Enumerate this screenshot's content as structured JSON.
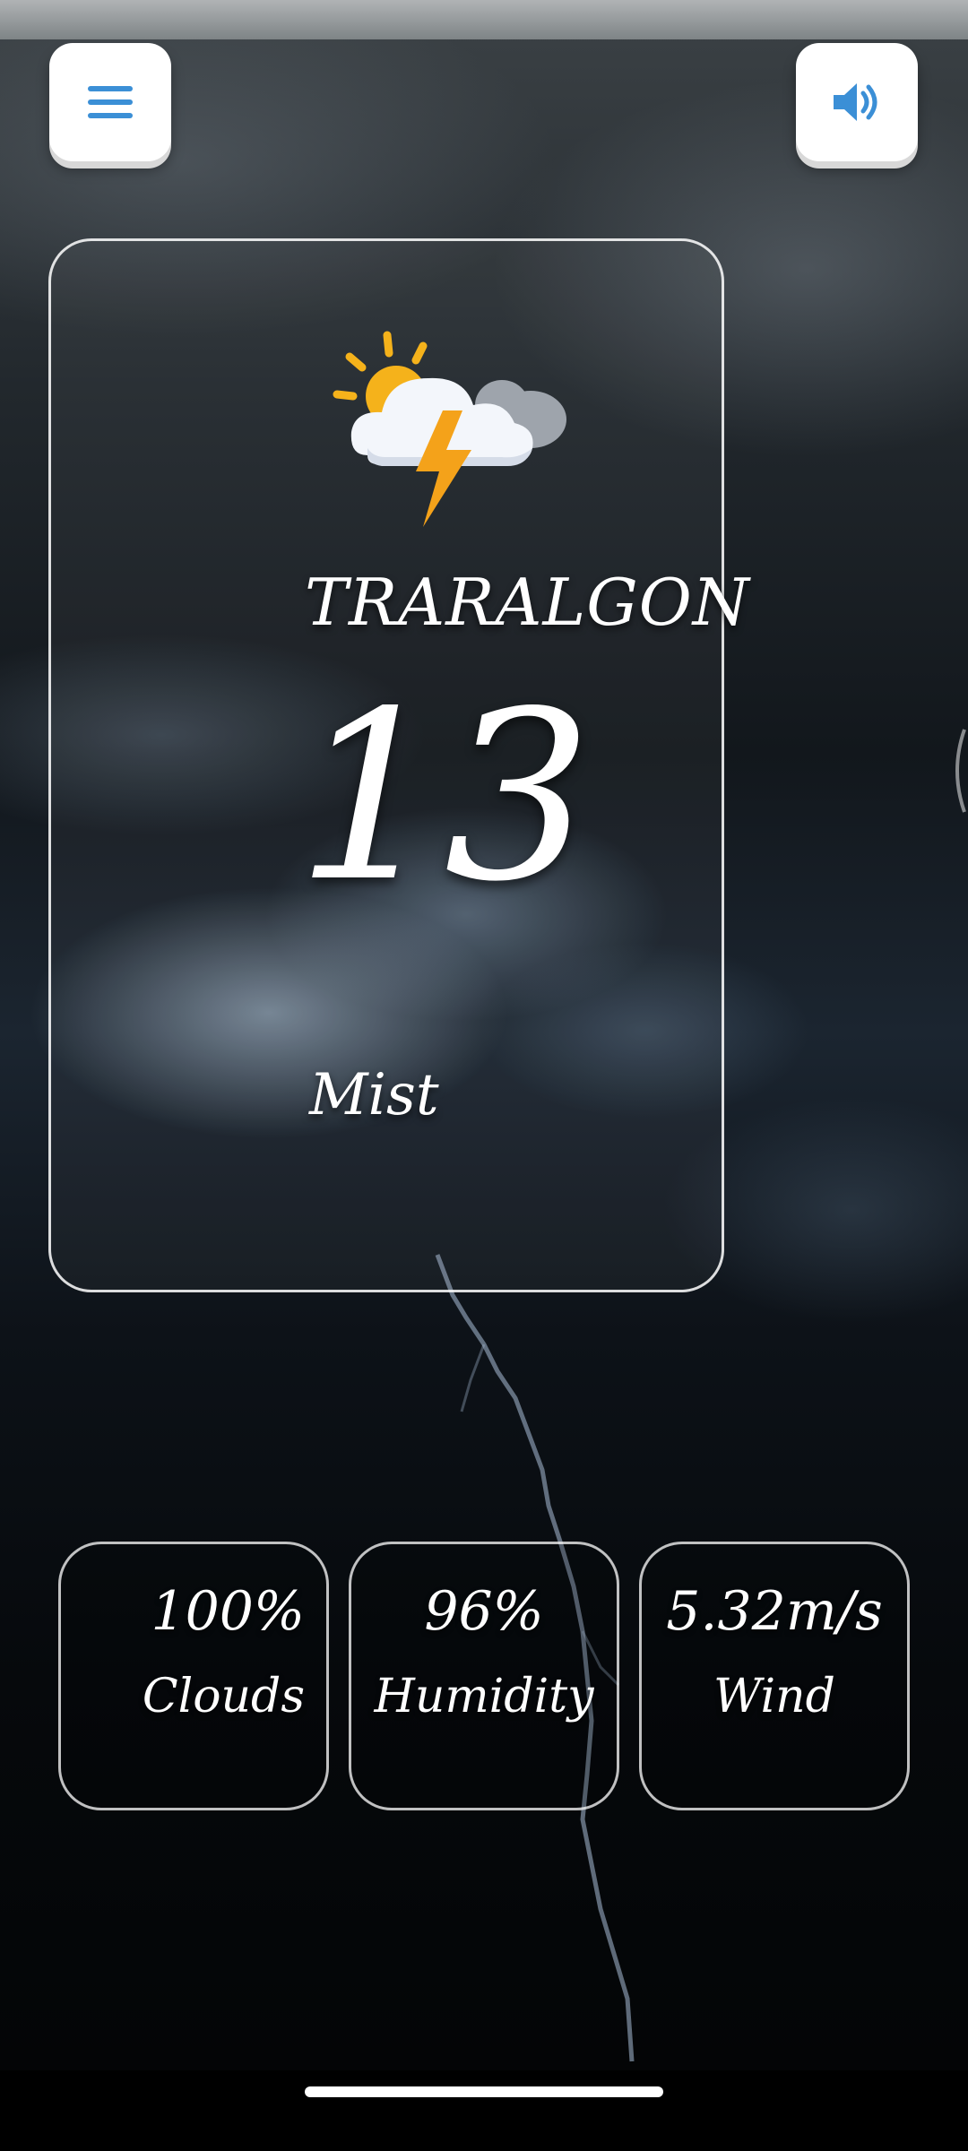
{
  "header": {
    "menu_icon": "hamburger-menu-icon",
    "sound_icon": "speaker-volume-icon",
    "accent_color": "#3b8fd6"
  },
  "weather": {
    "icon": "sun-cloud-lightning-icon",
    "city": "TRARALGON",
    "temperature": "13",
    "condition": "Mist"
  },
  "stats": [
    {
      "value": "100%",
      "label": "Clouds"
    },
    {
      "value": "96%",
      "label": "Humidity"
    },
    {
      "value": "5.32m/s",
      "label": "Wind"
    }
  ]
}
